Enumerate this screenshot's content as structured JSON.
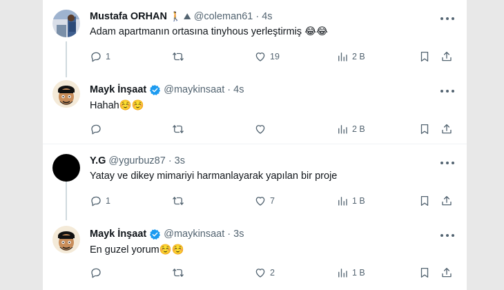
{
  "tweets": [
    {
      "name": "Mustafa ORHAN",
      "badges": "🚶 ⛰",
      "handle": "@coleman61",
      "dot": "·",
      "time": "4s",
      "text": "Adam apartmanın ortasına tinyhous yerleştirmiş 😂😂",
      "replies": "1",
      "retweets": "",
      "likes": "19",
      "views": "2 B",
      "verified": false,
      "avatar": "photo"
    },
    {
      "name": "Mayk İnşaat",
      "handle": "@maykinsaat",
      "dot": "·",
      "time": "4s",
      "text": "Hahah☺️☺️",
      "replies": "",
      "retweets": "",
      "likes": "",
      "views": "2 B",
      "verified": true,
      "avatar": "cartoon"
    },
    {
      "name": "Y.G",
      "handle": "@ygurbuz87",
      "dot": "·",
      "time": "3s",
      "text": "Yatay ve dikey mimariyi harmanlayarak yapılan bir proje",
      "replies": "1",
      "retweets": "",
      "likes": "7",
      "views": "1 B",
      "verified": false,
      "avatar": "black"
    },
    {
      "name": "Mayk İnşaat",
      "handle": "@maykinsaat",
      "dot": "·",
      "time": "3s",
      "text": "En guzel yorum☺️☺️",
      "replies": "",
      "retweets": "",
      "likes": "2",
      "views": "1 B",
      "verified": true,
      "avatar": "cartoon"
    }
  ],
  "colors": {
    "verified": "#1d9bf0",
    "meta": "#536471",
    "divider": "#eff3f4",
    "thread": "#cfd9de"
  },
  "icons": [
    "reply-icon",
    "retweet-icon",
    "like-icon",
    "views-icon",
    "bookmark-icon",
    "share-icon",
    "more-icon",
    "verified-icon"
  ]
}
